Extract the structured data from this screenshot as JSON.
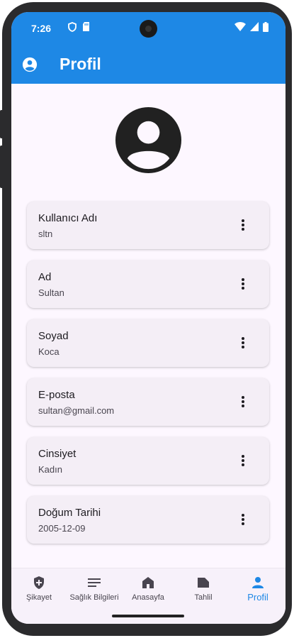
{
  "status_bar": {
    "time": "7:26",
    "left_icons": [
      "shield-icon",
      "sd-card-icon"
    ],
    "right_icons": [
      "wifi-icon",
      "signal-icon",
      "battery-icon"
    ]
  },
  "app_bar": {
    "title": "Profil",
    "icon": "account-circle-icon",
    "color": "#1e88e5"
  },
  "profile": {
    "avatar_icon": "account-circle-icon",
    "fields": [
      {
        "label": "Kullanıcı Adı",
        "value": "sltn"
      },
      {
        "label": "Ad",
        "value": "Sultan"
      },
      {
        "label": "Soyad",
        "value": "Koca"
      },
      {
        "label": "E-posta",
        "value": "sultan@gmail.com"
      },
      {
        "label": "Cinsiyet",
        "value": "Kadın"
      },
      {
        "label": "Doğum Tarihi",
        "value": "2005-12-09"
      }
    ]
  },
  "bottom_nav": {
    "items": [
      {
        "label": "Şikayet",
        "icon": "shield-plus-icon"
      },
      {
        "label": "Sağlık Bilgileri",
        "icon": "list-icon"
      },
      {
        "label": "Anasayfa",
        "icon": "home-icon"
      },
      {
        "label": "Tahlil",
        "icon": "label-icon"
      },
      {
        "label": "Profil",
        "icon": "person-icon"
      }
    ],
    "active_index": 4,
    "active_color": "#1e88e5"
  }
}
